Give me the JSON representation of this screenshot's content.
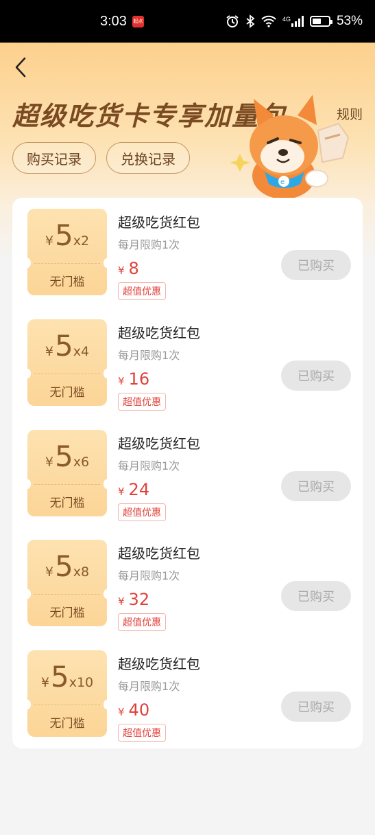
{
  "status_bar": {
    "time": "3:03",
    "app_badge": "起点",
    "network": "4G",
    "battery": "53%",
    "battery_level": 0.53,
    "icons": [
      "alarm-icon",
      "bluetooth-icon",
      "wifi-icon",
      "signal-icon",
      "battery-icon"
    ]
  },
  "header": {
    "back_icon": "back-arrow-icon",
    "title": "超级吃货卡专享加量包",
    "rules": "规则",
    "buy_records": "购买记录",
    "exchange_records": "兑换记录",
    "mascot": "shiba-mascot-illustration"
  },
  "items": [
    {
      "yen": "¥",
      "amount": "5",
      "multiplier": "x2",
      "threshold": "无门槛",
      "name": "超级吃货红包",
      "limit": "每月限购1次",
      "price_symbol": "¥",
      "price": "8",
      "tag": "超值优惠",
      "button": "已购买"
    },
    {
      "yen": "¥",
      "amount": "5",
      "multiplier": "x4",
      "threshold": "无门槛",
      "name": "超级吃货红包",
      "limit": "每月限购1次",
      "price_symbol": "¥",
      "price": "16",
      "tag": "超值优惠",
      "button": "已购买"
    },
    {
      "yen": "¥",
      "amount": "5",
      "multiplier": "x6",
      "threshold": "无门槛",
      "name": "超级吃货红包",
      "limit": "每月限购1次",
      "price_symbol": "¥",
      "price": "24",
      "tag": "超值优惠",
      "button": "已购买"
    },
    {
      "yen": "¥",
      "amount": "5",
      "multiplier": "x8",
      "threshold": "无门槛",
      "name": "超级吃货红包",
      "limit": "每月限购1次",
      "price_symbol": "¥",
      "price": "32",
      "tag": "超值优惠",
      "button": "已购买"
    },
    {
      "yen": "¥",
      "amount": "5",
      "multiplier": "x10",
      "threshold": "无门槛",
      "name": "超级吃货红包",
      "limit": "每月限购1次",
      "price_symbol": "¥",
      "price": "40",
      "tag": "超值优惠",
      "button": "已购买"
    }
  ],
  "colors": {
    "title": "#7a4a21",
    "accent_price": "#e0413a",
    "coupon_bg": "#fcd597",
    "disabled_button": "#e6e6e6"
  }
}
